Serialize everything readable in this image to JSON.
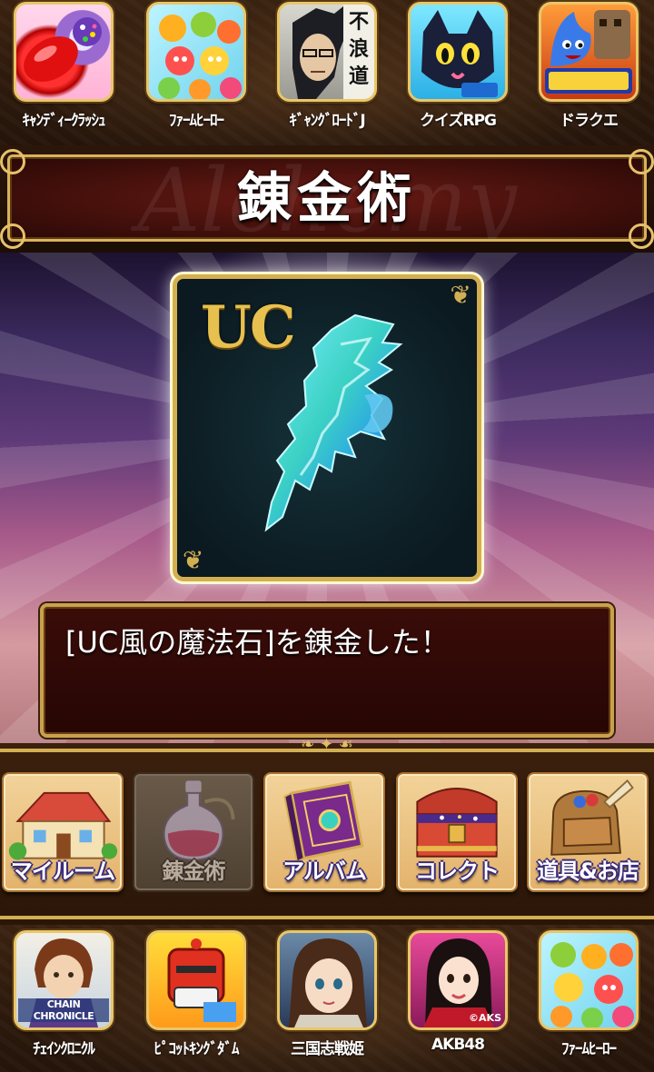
{
  "top_ads": [
    {
      "label": "ｷｬﾝﾃﾞｨｰｸﾗｯｼｭ",
      "icon": "candy-crush-icon"
    },
    {
      "label": "ﾌｧｰﾑﾋｰﾛｰ",
      "icon": "farm-heroes-icon"
    },
    {
      "label": "ｷﾞｬﾝｸﾞﾛｰﾄﾞJ",
      "icon": "gang-road-j-icon",
      "icon_text": "不浪道"
    },
    {
      "label": "クイズRPG",
      "icon": "quiz-rpg-icon"
    },
    {
      "label": "ドラクエ",
      "icon": "dragon-quest-icon"
    }
  ],
  "banner": {
    "title": "錬金術",
    "watermark": "Alchemy"
  },
  "card": {
    "rarity": "UC",
    "item_icon": "wind-magic-stone-icon"
  },
  "message": {
    "text": "[UC風の魔法石]を錬金した！"
  },
  "menu": [
    {
      "label": "マイルーム",
      "icon": "house-icon",
      "active": false
    },
    {
      "label": "錬金術",
      "icon": "potion-bottle-icon",
      "active": true
    },
    {
      "label": "アルバム",
      "icon": "album-book-icon",
      "active": false
    },
    {
      "label": "コレクト",
      "icon": "treasure-chest-icon",
      "active": false
    },
    {
      "label": "道具&お店",
      "icon": "item-bag-icon",
      "active": false
    }
  ],
  "bottom_ads": [
    {
      "label": "ﾁｪｲﾝｸﾛﾆｸﾙ",
      "icon": "chain-chronicle-icon",
      "icon_text": "CHAIN CHRONICLE"
    },
    {
      "label": "ﾋﾟｺｯﾄｷﾝｸﾞﾀﾞﾑ",
      "icon": "picotto-kingdom-icon"
    },
    {
      "label": "三国志戦姫",
      "icon": "sangokushi-senki-icon"
    },
    {
      "label": "AKB48",
      "icon": "akb48-icon",
      "icon_text": "©AKS"
    },
    {
      "label": "ﾌｧｰﾑﾋｰﾛｰ",
      "icon": "farm-heroes-icon"
    }
  ]
}
